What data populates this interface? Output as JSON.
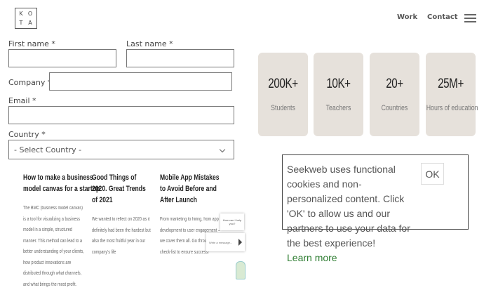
{
  "header": {
    "logo_letters": [
      "K",
      "O",
      "T",
      "A"
    ],
    "nav": {
      "work": "Work",
      "contact": "Contact"
    },
    "menu_icon": "hamburger-menu-icon"
  },
  "form": {
    "first_name_label": "First name *",
    "last_name_label": "Last name *",
    "company_label": "Company *",
    "email_label": "Email *",
    "country_label": "Country *",
    "country_value": "- Select Country -"
  },
  "stats": [
    {
      "value": "200K+",
      "label": "Students"
    },
    {
      "value": "10K+",
      "label": "Teachers"
    },
    {
      "value": "20+",
      "label": "Countries"
    },
    {
      "value": "25M+",
      "label": "Hours of education"
    }
  ],
  "blog": [
    {
      "title": "How to make a business model canvas for a startup",
      "excerpt": "The BMC (business model canvas) is a tool for visualizing a business model in a simple, structured manner. This method can lead to a better understanding of your clients, how product innovations are distributed through what channels, and what brings the most profit."
    },
    {
      "title": "Good Things of 2020. Great Trends of 2021",
      "excerpt": "We wanted to reflect on 2020 as it definitely had been the hardest but also the most fruitful year in our company's life"
    },
    {
      "title": "Mobile App Mistakes to Avoid Before and After Launch",
      "excerpt": "From marketing to hiring, from app development to user engagement – we cover them all. Go through this check-list to ensure success!"
    }
  ],
  "chat": {
    "bubble": "How can I help you?",
    "input_placeholder": "Write a message..."
  },
  "cookie": {
    "text": "Seekweb uses functional cookies and non-personalized content. Click 'OK' to allow us and our partners to use your data for the best experience!",
    "ok_label": "OK",
    "learn_more": "Learn more",
    "link_color": "#2e7d32"
  }
}
